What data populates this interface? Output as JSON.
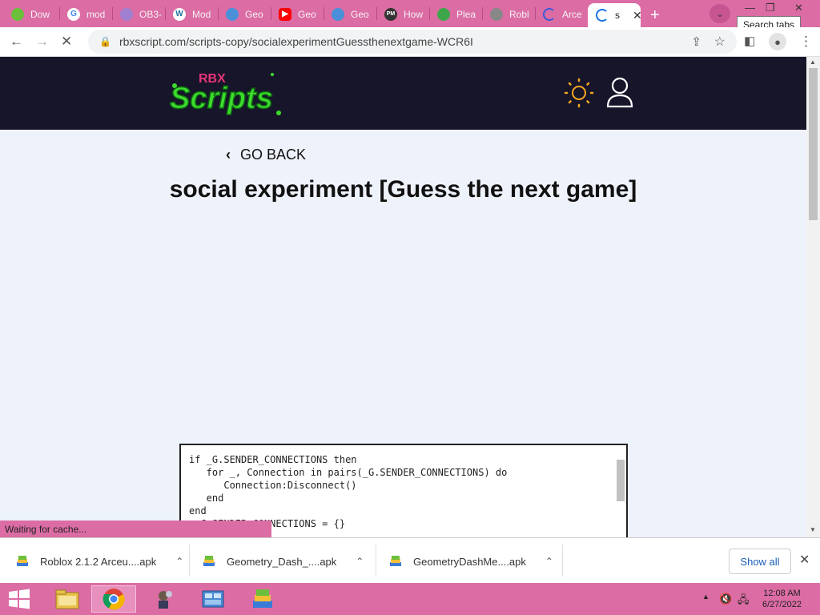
{
  "browser": {
    "tabs": [
      {
        "label": "Dow",
        "icon": "bluestacks-icon"
      },
      {
        "label": "mod",
        "icon": "google-icon"
      },
      {
        "label": "OB3-",
        "icon": "obs-icon"
      },
      {
        "label": "Mod",
        "icon": "wordpress-icon"
      },
      {
        "label": "Geo",
        "icon": "geometry-icon"
      },
      {
        "label": "Geo",
        "icon": "youtube-icon"
      },
      {
        "label": "Geo",
        "icon": "geometry-icon"
      },
      {
        "label": "How",
        "icon": "pm-icon"
      },
      {
        "label": "Plea",
        "icon": "android-icon"
      },
      {
        "label": "Robl",
        "icon": "roblox-icon"
      },
      {
        "label": "Arce",
        "icon": "loading-icon"
      },
      {
        "label": "s",
        "icon": "loading-icon"
      }
    ],
    "tooltip": "Search tabs",
    "url": "rbxscript.com/scripts-copy/socialexperimentGuessthenextgame-WCR6I"
  },
  "site": {
    "logo_top": "RBX",
    "logo_main": "Scripts",
    "go_back": "GO BACK",
    "title": "social experiment [Guess the next game]",
    "code_lines": [
      "if _G.SENDER_CONNECTIONS then",
      "   for _, Connection in pairs(_G.SENDER_CONNECTIONS) do",
      "      Connection:Disconnect()",
      "   end",
      "end",
      " _G.SENDER_CONNECTIONS = {}"
    ]
  },
  "status_text": "Waiting for cache...",
  "downloads": {
    "items": [
      "Roblox 2.1.2 Arceu....apk",
      "Geometry_Dash_....apk",
      "GeometryDashMe....apk"
    ],
    "show_all": "Show all"
  },
  "taskbar": {
    "time": "12:08 AM",
    "date": "6/27/2022"
  },
  "colors": {
    "accent_pink": "#dc6ca4",
    "site_header": "#171529",
    "logo_green": "#3ddc2e",
    "sun_orange": "#f5a623"
  }
}
